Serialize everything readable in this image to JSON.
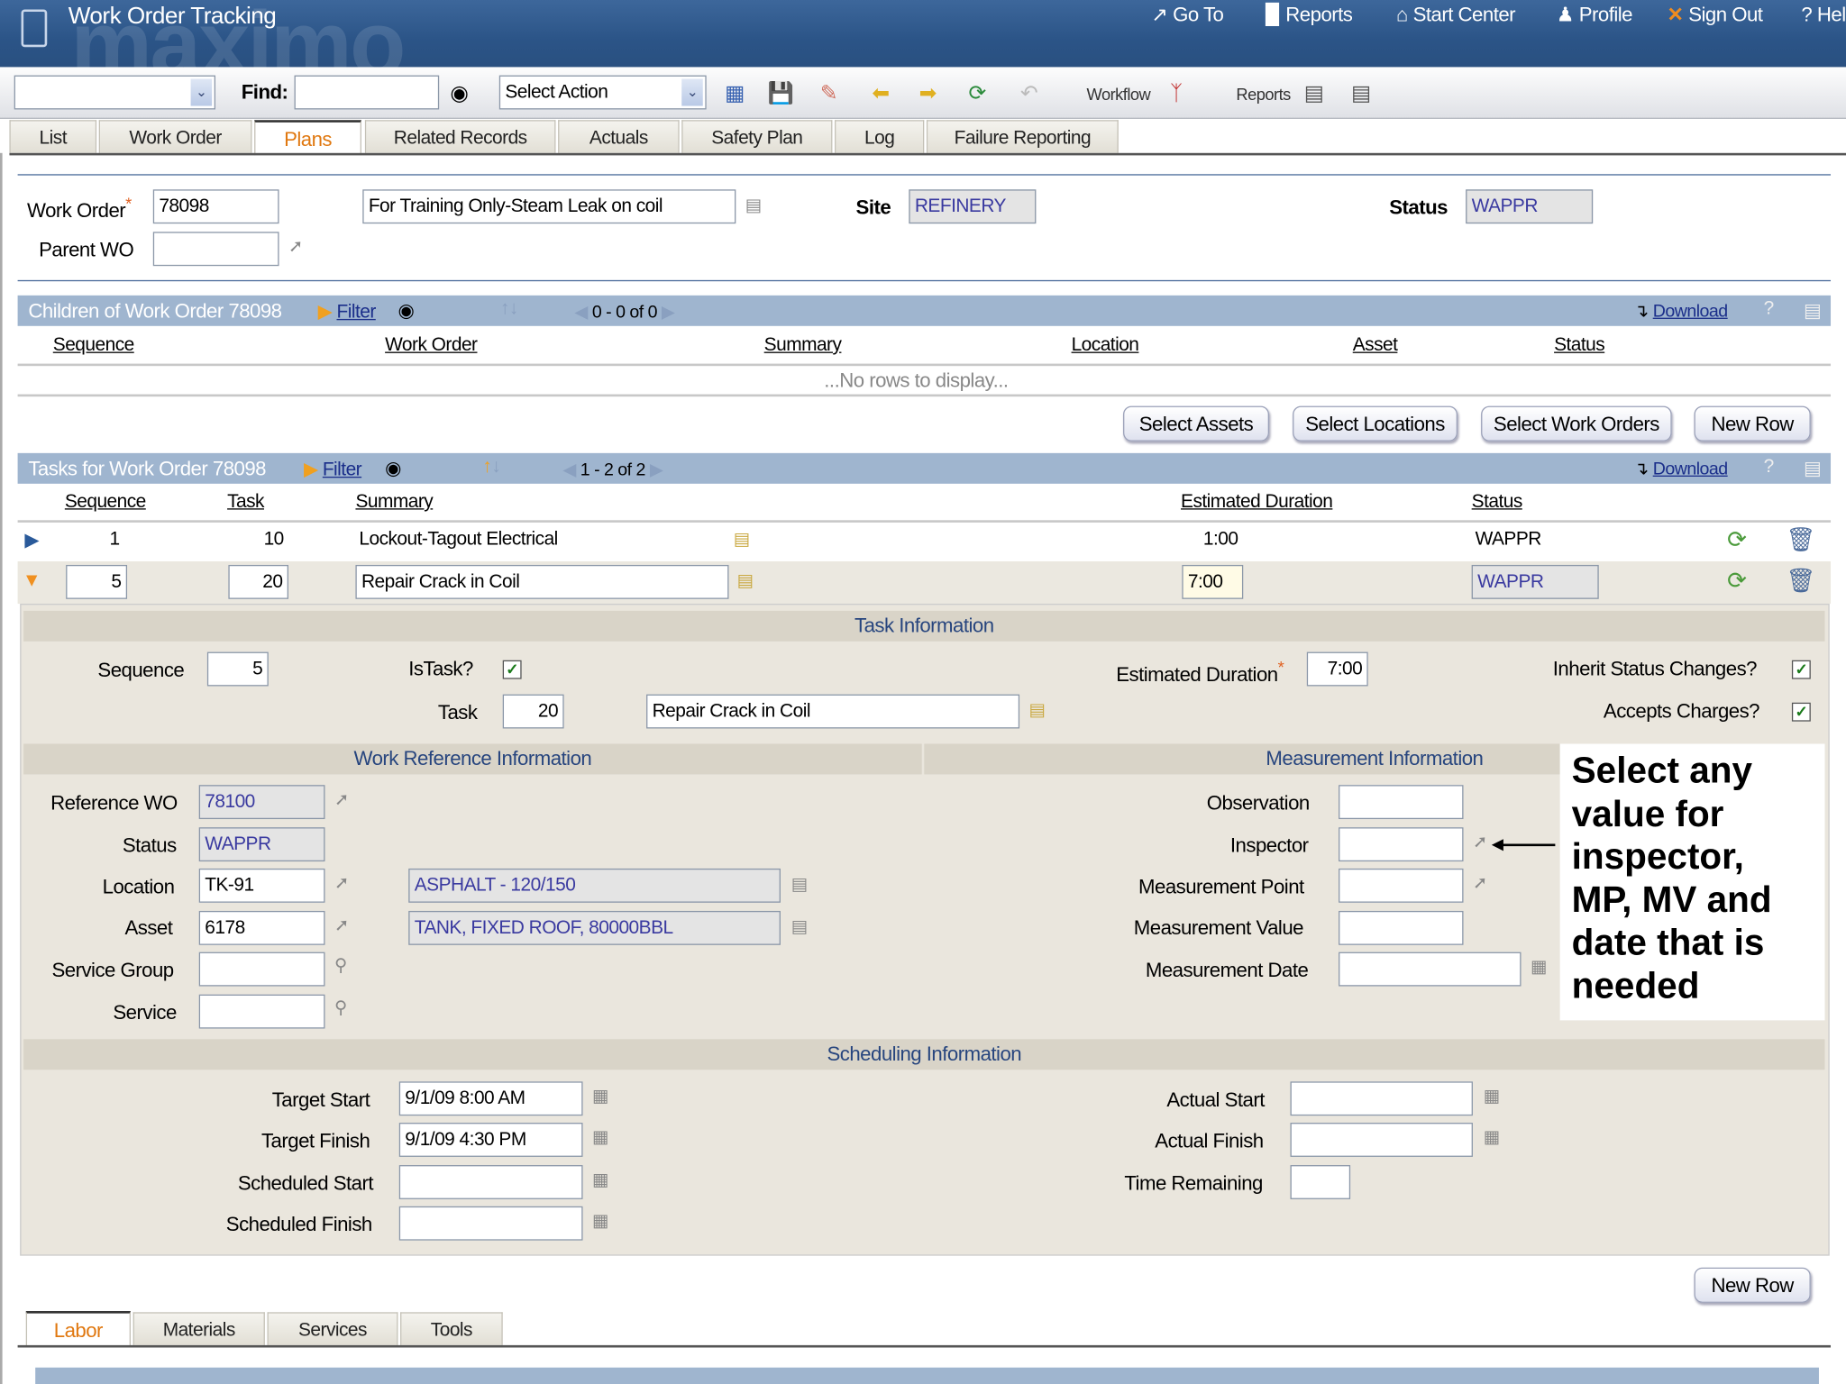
{
  "header": {
    "app_title": "Work Order Tracking",
    "logo_text": "maximo",
    "links": [
      "Go To",
      "Reports",
      "Start Center",
      "Profile",
      "Sign Out",
      "Help"
    ]
  },
  "toolbar": {
    "query_select_value": "",
    "find_label": "Find:",
    "find_value": "",
    "action_select": "Select Action",
    "workflow_label": "Workflow",
    "reports_label": "Reports"
  },
  "tabs": [
    "List",
    "Work Order",
    "Plans",
    "Related Records",
    "Actuals",
    "Safety Plan",
    "Log",
    "Failure Reporting"
  ],
  "active_tab": "Plans",
  "record": {
    "work_order_label": "Work Order",
    "work_order": "78098",
    "description": "For Training Only-Steam Leak on coil",
    "site_label": "Site",
    "site": "REFINERY",
    "status_label": "Status",
    "status": "WAPPR",
    "parent_wo_label": "Parent WO",
    "parent_wo": ""
  },
  "children": {
    "title": "Children of Work Order 78098",
    "filter": "Filter",
    "pager": "0 - 0 of 0",
    "download": "Download",
    "help": "?",
    "columns": [
      "Sequence",
      "Work Order",
      "Summary",
      "Location",
      "Asset",
      "Status"
    ],
    "empty_text": "...No rows to display...",
    "buttons": [
      "Select Assets",
      "Select Locations",
      "Select Work Orders",
      "New Row"
    ]
  },
  "tasks": {
    "title": "Tasks for Work Order 78098",
    "filter": "Filter",
    "pager": "1 - 2 of 2",
    "download": "Download",
    "help": "?",
    "columns": [
      "Sequence",
      "Task",
      "Summary",
      "Estimated Duration",
      "Status"
    ],
    "rows": [
      {
        "sequence": "1",
        "task": "10",
        "summary": "Lockout-Tagout Electrical",
        "duration": "1:00",
        "status": "WAPPR"
      },
      {
        "sequence": "5",
        "task": "20",
        "summary": "Repair Crack in Coil",
        "duration": "7:00",
        "status": "WAPPR"
      }
    ]
  },
  "task_info": {
    "title": "Task Information",
    "sequence_label": "Sequence",
    "sequence": "5",
    "istask_label": "IsTask?",
    "istask": true,
    "est_duration_label": "Estimated Duration",
    "est_duration": "7:00",
    "inherit_label": "Inherit Status Changes?",
    "inherit": true,
    "task_label": "Task",
    "task": "20",
    "task_desc": "Repair Crack in Coil",
    "accepts_label": "Accepts Charges?",
    "accepts": true
  },
  "work_ref": {
    "title": "Work Reference Information",
    "reference_wo_label": "Reference WO",
    "reference_wo": "78100",
    "status_label": "Status",
    "status": "WAPPR",
    "location_label": "Location",
    "location": "TK-91",
    "location_desc": "ASPHALT - 120/150",
    "asset_label": "Asset",
    "asset": "6178",
    "asset_desc": "TANK, FIXED ROOF, 80000BBL",
    "service_group_label": "Service Group",
    "service_group": "",
    "service_label": "Service",
    "service": ""
  },
  "measurement": {
    "title": "Measurement Information",
    "observation_label": "Observation",
    "inspector_label": "Inspector",
    "point_label": "Measurement Point",
    "value_label": "Measurement Value",
    "date_label": "Measurement Date"
  },
  "annotation": [
    "Select any",
    "value for",
    "inspector,",
    "MP, MV and",
    "date that is",
    "needed"
  ],
  "scheduling": {
    "title": "Scheduling Information",
    "target_start_label": "Target Start",
    "target_start": "9/1/09 8:00 AM",
    "target_finish_label": "Target Finish",
    "target_finish": "9/1/09 4:30 PM",
    "scheduled_start_label": "Scheduled Start",
    "scheduled_start": "",
    "scheduled_finish_label": "Scheduled Finish",
    "scheduled_finish": "",
    "actual_start_label": "Actual Start",
    "actual_start": "",
    "actual_finish_label": "Actual Finish",
    "actual_finish": "",
    "time_remaining_label": "Time Remaining",
    "time_remaining": ""
  },
  "bottom": {
    "new_row": "New Row",
    "tabs": [
      "Labor",
      "Materials",
      "Services",
      "Tools"
    ]
  },
  "colors": {
    "header": "#2b5487",
    "section_bar": "#9fb5cf",
    "active_tab_text": "#e07810",
    "panel_bg": "#eae6dd"
  }
}
